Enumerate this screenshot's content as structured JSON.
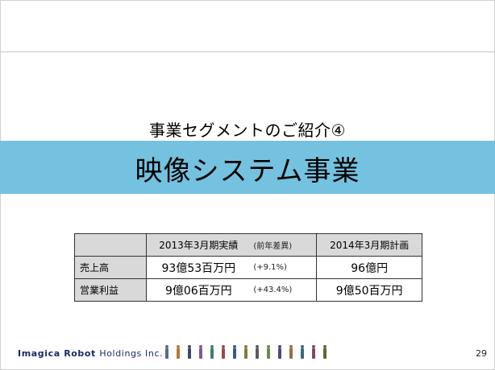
{
  "slide": {
    "subtitle": "事業セグメントのご紹介④",
    "title": "映像システム事業",
    "page_number": "29",
    "banner_color": "#74c2e0"
  },
  "table": {
    "header": {
      "col1_label": "2013年3月期実績",
      "col1_note": "(前年差異)",
      "col2_label": "2014年3月期計画"
    },
    "rows": [
      {
        "label": "売上高",
        "actual": "93億53百万円",
        "diff": "(+9.1%)",
        "plan": "96億円"
      },
      {
        "label": "営業利益",
        "actual": "9億06百万円",
        "diff": "(+43.4%)",
        "plan": "9億50百万円"
      }
    ]
  },
  "footer": {
    "logo_bold": "Imagica Robot",
    "logo_rest": "Holdings Inc.",
    "figures_icon": "people-row-icon"
  }
}
